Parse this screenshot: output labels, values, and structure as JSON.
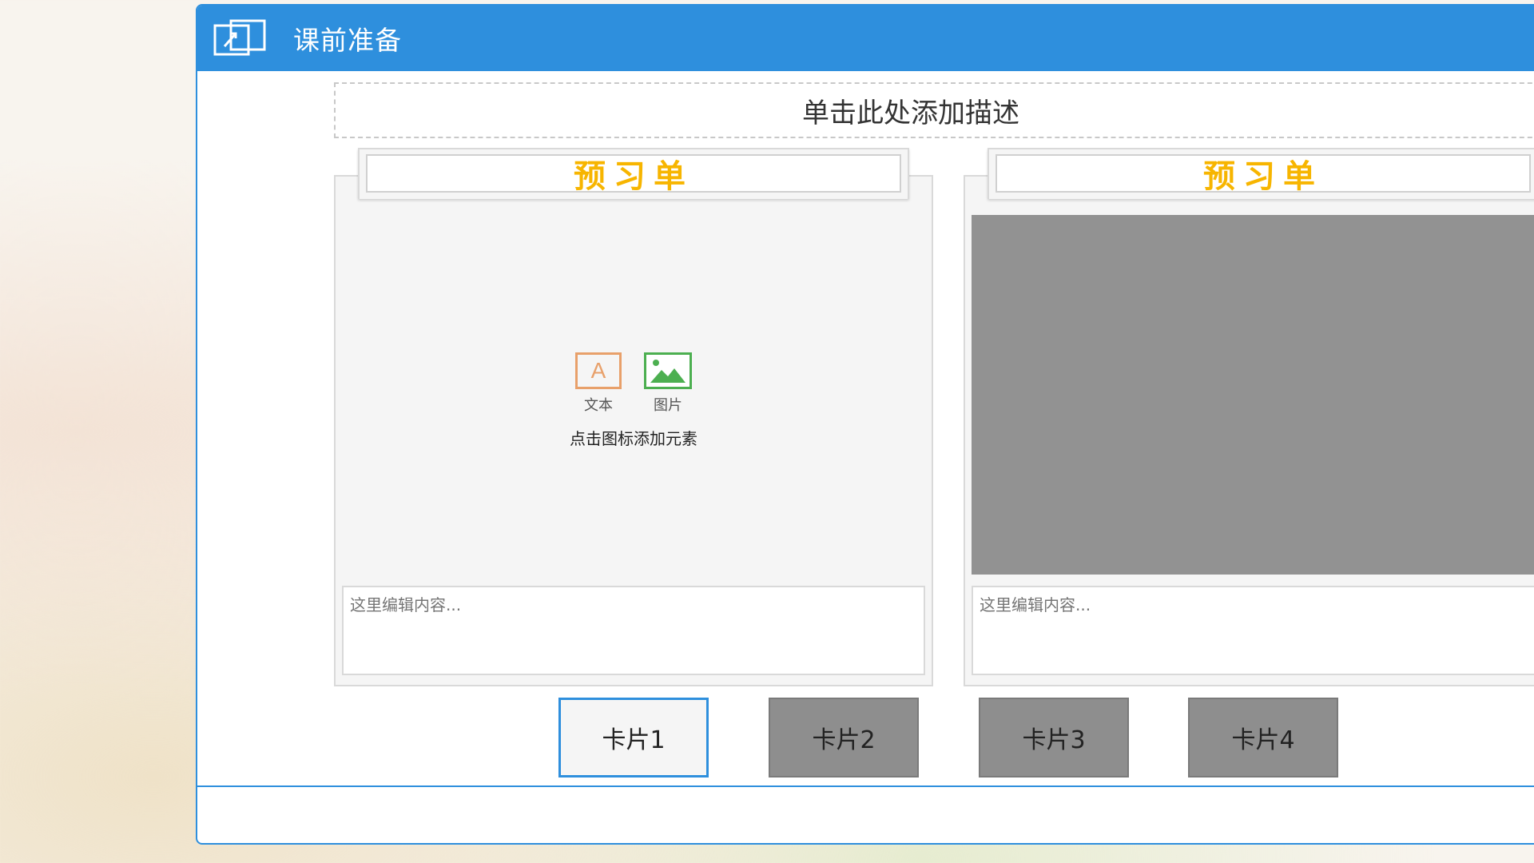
{
  "window": {
    "title": "课前准备",
    "title_icon": "switch-window-icon",
    "accent_color": "#2e8fdd"
  },
  "description_placeholder": "单击此处添加描述",
  "cards": [
    {
      "header": "预习单",
      "add_text_label": "文本",
      "add_image_label": "图片",
      "add_hint": "点击图标添加元素",
      "content_placeholder": "这里编辑内容..."
    },
    {
      "header": "预习单",
      "content_placeholder": "这里编辑内容..."
    }
  ],
  "card_tabs": [
    {
      "label": "卡片1",
      "active": true
    },
    {
      "label": "卡片2",
      "active": false
    },
    {
      "label": "卡片3",
      "active": false
    },
    {
      "label": "卡片4",
      "active": false
    }
  ],
  "colors": {
    "header_text": "#f7b500",
    "inactive_tab": "#8e8e8e",
    "image_placeholder": "#929292"
  }
}
